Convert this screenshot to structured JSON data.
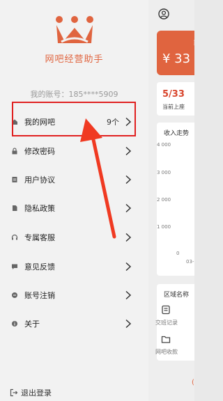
{
  "brand": {
    "name": "网吧经营助手",
    "color": "#e0643f"
  },
  "account": {
    "label": "我的账号：185****5909"
  },
  "menu": [
    {
      "label": "我的网吧",
      "count": "9个",
      "icon": "home-icon"
    },
    {
      "label": "修改密码",
      "count": "",
      "icon": "lock-icon"
    },
    {
      "label": "用户协议",
      "count": "",
      "icon": "document-icon"
    },
    {
      "label": "隐私政策",
      "count": "",
      "icon": "privacy-icon"
    },
    {
      "label": "专属客服",
      "count": "",
      "icon": "headset-icon"
    },
    {
      "label": "意见反馈",
      "count": "",
      "icon": "feedback-icon"
    },
    {
      "label": "账号注销",
      "count": "",
      "icon": "cancel-account-icon"
    },
    {
      "label": "关于",
      "count": "",
      "icon": "info-icon"
    }
  ],
  "logout": {
    "label": "退出登录"
  },
  "background": {
    "card_small": "当",
    "card_big": "¥ 33",
    "stat_value": "5/33",
    "stat_label": "当前上座",
    "chart_title": "收入走势",
    "ticks": [
      "4 000",
      "3 000",
      "2 000",
      "1 000",
      "0"
    ],
    "xtick": "03-",
    "region_title": "区域名称",
    "region_items": [
      "交班记录",
      "网吧收款"
    ],
    "bottom_text": "("
  },
  "annotation": {
    "highlight_color": "#e02020"
  }
}
